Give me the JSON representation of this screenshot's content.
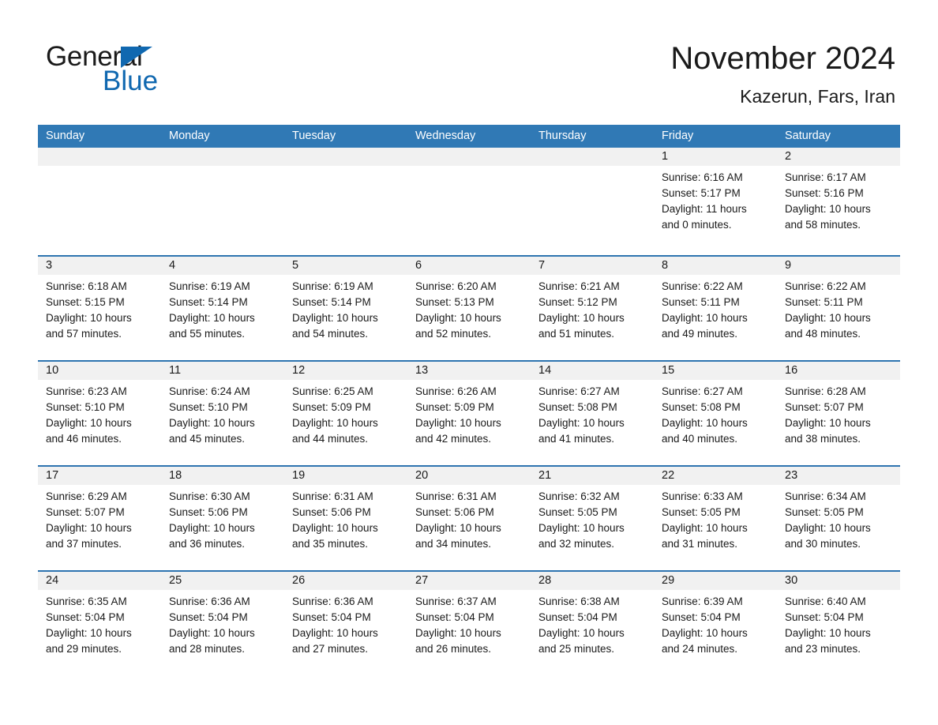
{
  "brand": {
    "line1": "General",
    "line2": "Blue",
    "triangle_icon": "brand-triangle-icon",
    "accent_color": "#1068b0"
  },
  "header": {
    "title": "November 2024",
    "subtitle": "Kazerun, Fars, Iran"
  },
  "colors": {
    "header_blue": "#3079b5",
    "row_divider_blue": "#2e74b0",
    "day_band_gray": "#f1f1f1",
    "text": "#1a1a1a"
  },
  "weekdays": [
    "Sunday",
    "Monday",
    "Tuesday",
    "Wednesday",
    "Thursday",
    "Friday",
    "Saturday"
  ],
  "weeks": [
    [
      {
        "day": "",
        "lines": []
      },
      {
        "day": "",
        "lines": []
      },
      {
        "day": "",
        "lines": []
      },
      {
        "day": "",
        "lines": []
      },
      {
        "day": "",
        "lines": []
      },
      {
        "day": "1",
        "lines": [
          "Sunrise: 6:16 AM",
          "Sunset: 5:17 PM",
          "Daylight: 11 hours",
          "and 0 minutes."
        ]
      },
      {
        "day": "2",
        "lines": [
          "Sunrise: 6:17 AM",
          "Sunset: 5:16 PM",
          "Daylight: 10 hours",
          "and 58 minutes."
        ]
      }
    ],
    [
      {
        "day": "3",
        "lines": [
          "Sunrise: 6:18 AM",
          "Sunset: 5:15 PM",
          "Daylight: 10 hours",
          "and 57 minutes."
        ]
      },
      {
        "day": "4",
        "lines": [
          "Sunrise: 6:19 AM",
          "Sunset: 5:14 PM",
          "Daylight: 10 hours",
          "and 55 minutes."
        ]
      },
      {
        "day": "5",
        "lines": [
          "Sunrise: 6:19 AM",
          "Sunset: 5:14 PM",
          "Daylight: 10 hours",
          "and 54 minutes."
        ]
      },
      {
        "day": "6",
        "lines": [
          "Sunrise: 6:20 AM",
          "Sunset: 5:13 PM",
          "Daylight: 10 hours",
          "and 52 minutes."
        ]
      },
      {
        "day": "7",
        "lines": [
          "Sunrise: 6:21 AM",
          "Sunset: 5:12 PM",
          "Daylight: 10 hours",
          "and 51 minutes."
        ]
      },
      {
        "day": "8",
        "lines": [
          "Sunrise: 6:22 AM",
          "Sunset: 5:11 PM",
          "Daylight: 10 hours",
          "and 49 minutes."
        ]
      },
      {
        "day": "9",
        "lines": [
          "Sunrise: 6:22 AM",
          "Sunset: 5:11 PM",
          "Daylight: 10 hours",
          "and 48 minutes."
        ]
      }
    ],
    [
      {
        "day": "10",
        "lines": [
          "Sunrise: 6:23 AM",
          "Sunset: 5:10 PM",
          "Daylight: 10 hours",
          "and 46 minutes."
        ]
      },
      {
        "day": "11",
        "lines": [
          "Sunrise: 6:24 AM",
          "Sunset: 5:10 PM",
          "Daylight: 10 hours",
          "and 45 minutes."
        ]
      },
      {
        "day": "12",
        "lines": [
          "Sunrise: 6:25 AM",
          "Sunset: 5:09 PM",
          "Daylight: 10 hours",
          "and 44 minutes."
        ]
      },
      {
        "day": "13",
        "lines": [
          "Sunrise: 6:26 AM",
          "Sunset: 5:09 PM",
          "Daylight: 10 hours",
          "and 42 minutes."
        ]
      },
      {
        "day": "14",
        "lines": [
          "Sunrise: 6:27 AM",
          "Sunset: 5:08 PM",
          "Daylight: 10 hours",
          "and 41 minutes."
        ]
      },
      {
        "day": "15",
        "lines": [
          "Sunrise: 6:27 AM",
          "Sunset: 5:08 PM",
          "Daylight: 10 hours",
          "and 40 minutes."
        ]
      },
      {
        "day": "16",
        "lines": [
          "Sunrise: 6:28 AM",
          "Sunset: 5:07 PM",
          "Daylight: 10 hours",
          "and 38 minutes."
        ]
      }
    ],
    [
      {
        "day": "17",
        "lines": [
          "Sunrise: 6:29 AM",
          "Sunset: 5:07 PM",
          "Daylight: 10 hours",
          "and 37 minutes."
        ]
      },
      {
        "day": "18",
        "lines": [
          "Sunrise: 6:30 AM",
          "Sunset: 5:06 PM",
          "Daylight: 10 hours",
          "and 36 minutes."
        ]
      },
      {
        "day": "19",
        "lines": [
          "Sunrise: 6:31 AM",
          "Sunset: 5:06 PM",
          "Daylight: 10 hours",
          "and 35 minutes."
        ]
      },
      {
        "day": "20",
        "lines": [
          "Sunrise: 6:31 AM",
          "Sunset: 5:06 PM",
          "Daylight: 10 hours",
          "and 34 minutes."
        ]
      },
      {
        "day": "21",
        "lines": [
          "Sunrise: 6:32 AM",
          "Sunset: 5:05 PM",
          "Daylight: 10 hours",
          "and 32 minutes."
        ]
      },
      {
        "day": "22",
        "lines": [
          "Sunrise: 6:33 AM",
          "Sunset: 5:05 PM",
          "Daylight: 10 hours",
          "and 31 minutes."
        ]
      },
      {
        "day": "23",
        "lines": [
          "Sunrise: 6:34 AM",
          "Sunset: 5:05 PM",
          "Daylight: 10 hours",
          "and 30 minutes."
        ]
      }
    ],
    [
      {
        "day": "24",
        "lines": [
          "Sunrise: 6:35 AM",
          "Sunset: 5:04 PM",
          "Daylight: 10 hours",
          "and 29 minutes."
        ]
      },
      {
        "day": "25",
        "lines": [
          "Sunrise: 6:36 AM",
          "Sunset: 5:04 PM",
          "Daylight: 10 hours",
          "and 28 minutes."
        ]
      },
      {
        "day": "26",
        "lines": [
          "Sunrise: 6:36 AM",
          "Sunset: 5:04 PM",
          "Daylight: 10 hours",
          "and 27 minutes."
        ]
      },
      {
        "day": "27",
        "lines": [
          "Sunrise: 6:37 AM",
          "Sunset: 5:04 PM",
          "Daylight: 10 hours",
          "and 26 minutes."
        ]
      },
      {
        "day": "28",
        "lines": [
          "Sunrise: 6:38 AM",
          "Sunset: 5:04 PM",
          "Daylight: 10 hours",
          "and 25 minutes."
        ]
      },
      {
        "day": "29",
        "lines": [
          "Sunrise: 6:39 AM",
          "Sunset: 5:04 PM",
          "Daylight: 10 hours",
          "and 24 minutes."
        ]
      },
      {
        "day": "30",
        "lines": [
          "Sunrise: 6:40 AM",
          "Sunset: 5:04 PM",
          "Daylight: 10 hours",
          "and 23 minutes."
        ]
      }
    ]
  ]
}
